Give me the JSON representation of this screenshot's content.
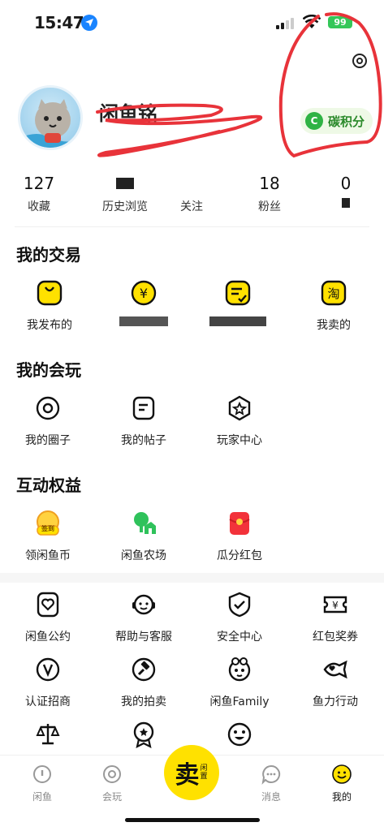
{
  "status_bar": {
    "time": "15:47",
    "battery": "99"
  },
  "profile": {
    "nickname": "闲鱼铭",
    "carbon_badge": {
      "icon_letter": "C",
      "label": "碳积分"
    }
  },
  "stats": [
    {
      "value": "127",
      "label": "收藏"
    },
    {
      "value": "",
      "label": "历史浏览"
    },
    {
      "value": "",
      "label": "关注"
    },
    {
      "value": "18",
      "label": "粉丝"
    },
    {
      "value": "0",
      "label": ""
    }
  ],
  "my_trades": {
    "title": "我的交易",
    "items": [
      {
        "label": "我发布的",
        "icon": "publish-icon"
      },
      {
        "label": "",
        "icon": "yen-coin-icon"
      },
      {
        "label": "",
        "icon": "bought-list-icon"
      },
      {
        "label": "我卖的",
        "icon": "taobao-icon"
      }
    ]
  },
  "my_play": {
    "title": "我的会玩",
    "items": [
      {
        "label": "我的圈子",
        "icon": "circle-icon"
      },
      {
        "label": "我的帖子",
        "icon": "post-icon"
      },
      {
        "label": "玩家中心",
        "icon": "star-badge-icon"
      }
    ]
  },
  "benefits": {
    "title": "互动权益",
    "items": [
      {
        "label": "领闲鱼币",
        "icon": "sign-in-coin-icon",
        "badge": "签到"
      },
      {
        "label": "闲鱼农场",
        "icon": "farm-icon"
      },
      {
        "label": "瓜分红包",
        "icon": "red-envelope-icon"
      }
    ]
  },
  "services": {
    "items": [
      {
        "label": "闲鱼公约",
        "icon": "heart-badge-icon"
      },
      {
        "label": "帮助与客服",
        "icon": "customer-service-icon"
      },
      {
        "label": "安全中心",
        "icon": "shield-check-icon"
      },
      {
        "label": "红包奖券",
        "icon": "coupon-icon"
      },
      {
        "label": "认证招商",
        "icon": "verified-v-icon"
      },
      {
        "label": "我的拍卖",
        "icon": "auction-hammer-icon"
      },
      {
        "label": "闲鱼Family",
        "icon": "family-icon"
      },
      {
        "label": "鱼力行动",
        "icon": "fish-heart-icon"
      },
      {
        "label": "",
        "icon": "scale-icon"
      },
      {
        "label": "",
        "icon": "medal-icon"
      },
      {
        "label": "",
        "icon": "emoji-icon"
      }
    ]
  },
  "tab_bar": {
    "tabs": [
      {
        "label": "闲鱼",
        "icon": "home-fish-icon"
      },
      {
        "label": "会玩",
        "icon": "play-circle-icon"
      },
      {
        "label": "消息",
        "icon": "message-icon"
      },
      {
        "label": "我的",
        "icon": "me-smile-icon"
      }
    ],
    "sell": {
      "main": "卖",
      "sub": "闲置"
    }
  },
  "colors": {
    "accent": "#ffe100",
    "carbon_green": "#2fb344",
    "scribble_red": "#e8333a"
  }
}
